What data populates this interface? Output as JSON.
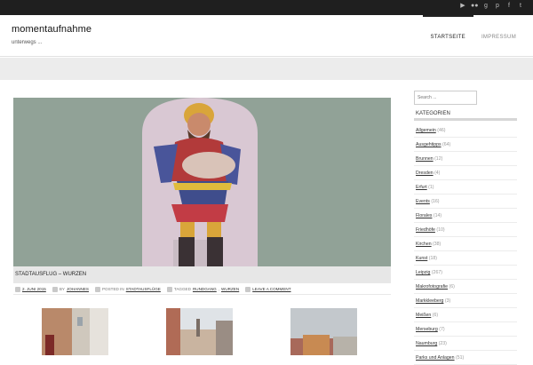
{
  "site": {
    "title": "momentaufnahme",
    "tagline": "unterwegs ..."
  },
  "topbar": {
    "social_icons": [
      "youtube-icon",
      "flickr-icon",
      "google-plus-icon",
      "pinterest-icon",
      "facebook-icon",
      "twitter-icon"
    ]
  },
  "nav": [
    {
      "label": "STARTSEITE",
      "active": true
    },
    {
      "label": "IMPRESSUM",
      "active": false
    }
  ],
  "post": {
    "title": "STADTAUSFLUG – WURZEN",
    "date": "2. JUNI 2015",
    "by_prefix": "BY",
    "author": "JOHANNES",
    "posted_prefix": "POSTED IN",
    "category": "STADTAUSFLÜGE",
    "tagged_prefix": "TAGGED",
    "tags": [
      "RUNDGANG",
      "WURZEN"
    ],
    "comment_link": "LEAVE A COMMENT"
  },
  "sidebar": {
    "search_placeholder": "Search ...",
    "categories_title": "KATEGORIEN",
    "categories": [
      {
        "name": "Allgemein",
        "count": "(46)"
      },
      {
        "name": "Ausgehtipps",
        "count": "(64)"
      },
      {
        "name": "Brunnen",
        "count": "(12)"
      },
      {
        "name": "Dresden",
        "count": "(4)"
      },
      {
        "name": "Erfurt",
        "count": "(1)"
      },
      {
        "name": "Events",
        "count": "(16)"
      },
      {
        "name": "Florales",
        "count": "(14)"
      },
      {
        "name": "Friedhöfe",
        "count": "(10)"
      },
      {
        "name": "Kirchen",
        "count": "(38)"
      },
      {
        "name": "Kunst",
        "count": "(18)"
      },
      {
        "name": "Leipzig",
        "count": "(267)"
      },
      {
        "name": "Makrofotografie",
        "count": "(6)"
      },
      {
        "name": "Markkleeberg",
        "count": "(3)"
      },
      {
        "name": "Meißen",
        "count": "(6)"
      },
      {
        "name": "Merseburg",
        "count": "(7)"
      },
      {
        "name": "Naumburg",
        "count": "(23)"
      },
      {
        "name": "Parks und Anlagen",
        "count": "(51)"
      }
    ]
  },
  "colors": {
    "topbar": "#1f1f1f",
    "band": "#ececec",
    "title_bar": "#e7e7e7"
  }
}
